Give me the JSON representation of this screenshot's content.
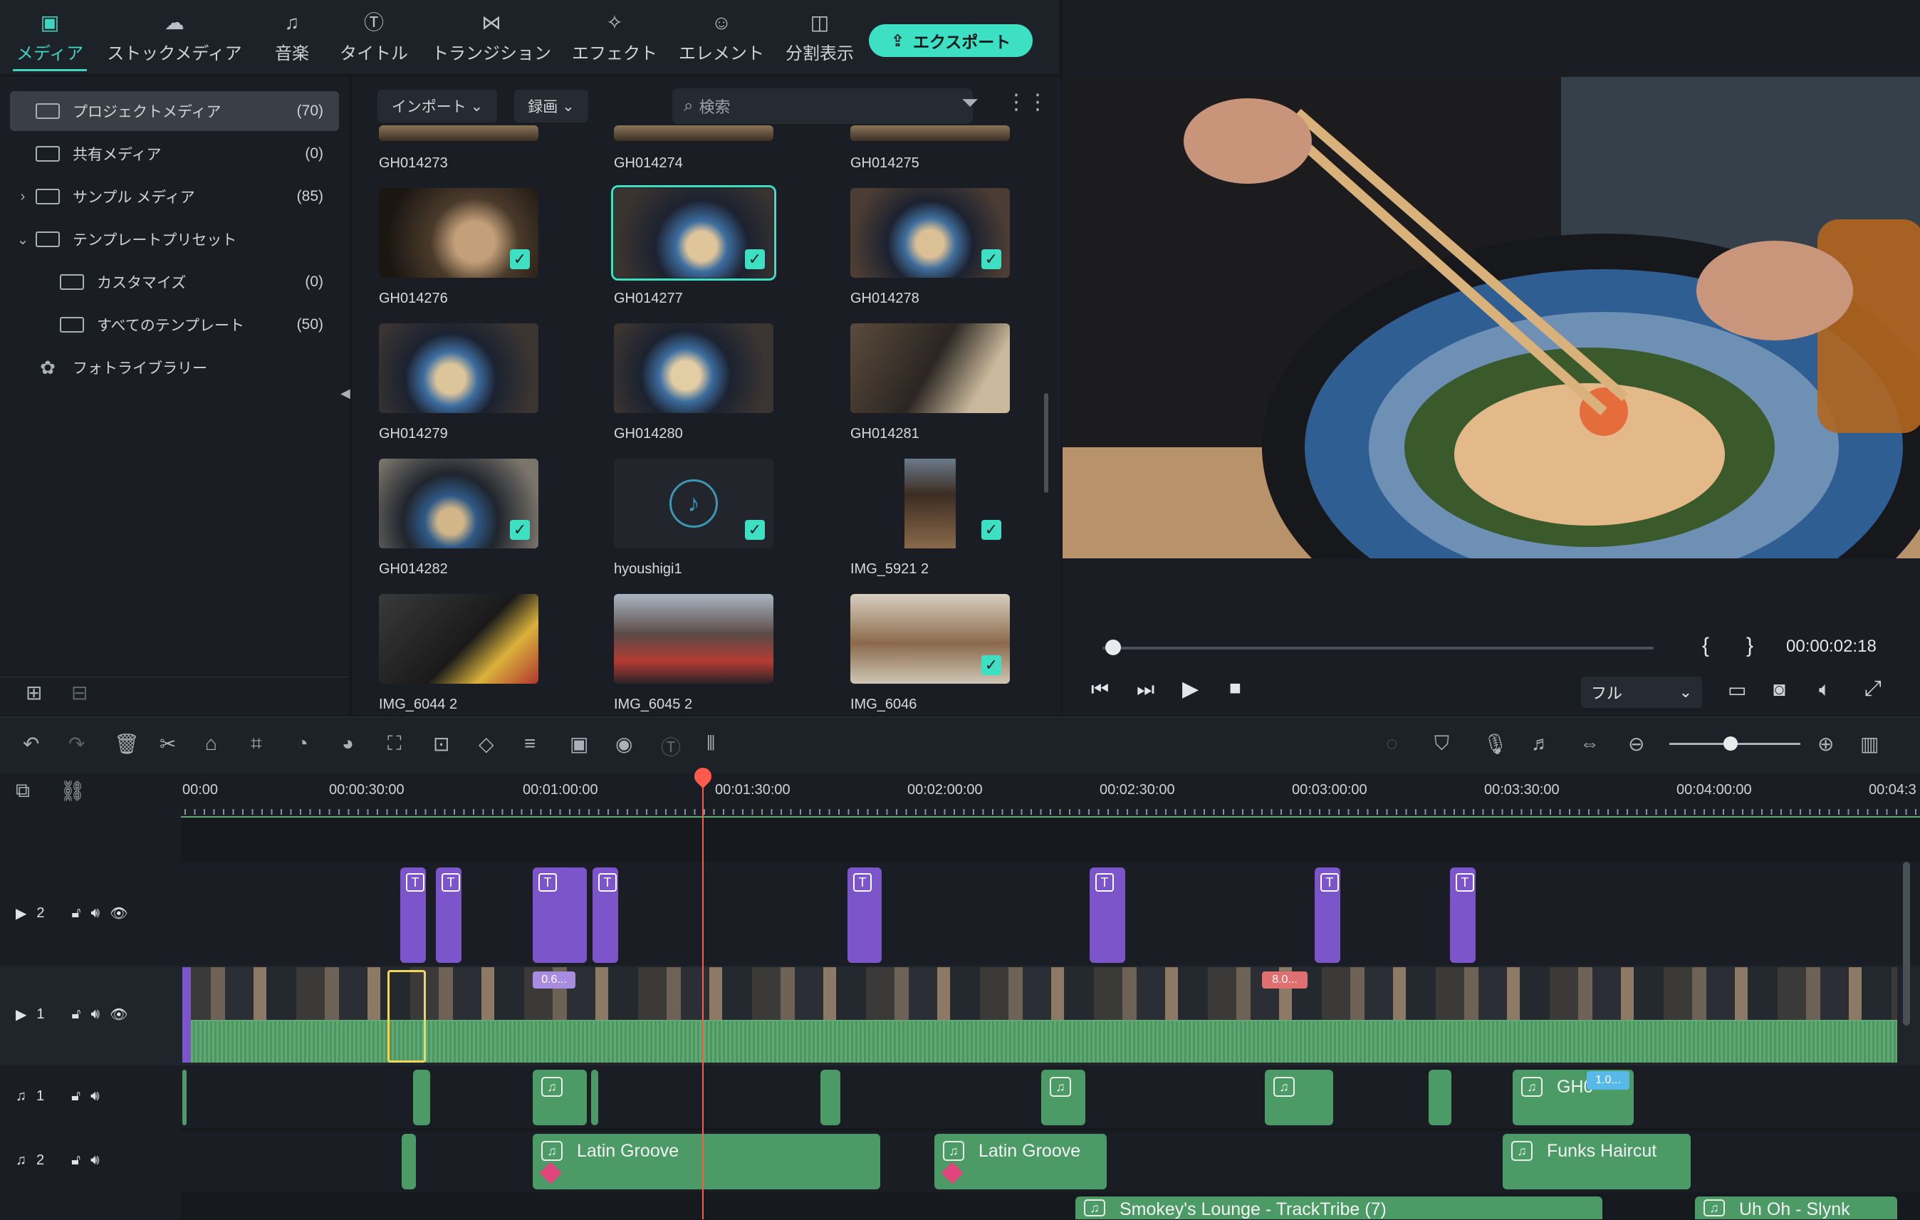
{
  "tabs": [
    {
      "label": "メディア",
      "icon": "media-icon"
    },
    {
      "label": "ストックメディア",
      "icon": "stock-media-icon"
    },
    {
      "label": "音楽",
      "icon": "music-icon"
    },
    {
      "label": "タイトル",
      "icon": "title-icon"
    },
    {
      "label": "トランジション",
      "icon": "transition-icon"
    },
    {
      "label": "エフェクト",
      "icon": "effect-icon"
    },
    {
      "label": "エレメント",
      "icon": "element-icon"
    },
    {
      "label": "分割表示",
      "icon": "split-screen-icon"
    }
  ],
  "export_label": "エクスポート",
  "sidebar": {
    "items": [
      {
        "label": "プロジェクトメディア",
        "count": "(70)"
      },
      {
        "label": "共有メディア",
        "count": "(0)"
      },
      {
        "label": "サンプル メディア",
        "count": "(85)"
      },
      {
        "label": "テンプレートプリセット",
        "count": ""
      },
      {
        "label": "カスタマイズ",
        "count": "(0)"
      },
      {
        "label": "すべてのテンプレート",
        "count": "(50)"
      },
      {
        "label": "フォトライブラリー",
        "count": ""
      }
    ]
  },
  "browser": {
    "import_label": "インポート",
    "record_label": "録画",
    "search_placeholder": "検索",
    "items": [
      {
        "name": "GH014273",
        "checked": false
      },
      {
        "name": "GH014274",
        "checked": false
      },
      {
        "name": "GH014275",
        "checked": false
      },
      {
        "name": "GH014276",
        "checked": true
      },
      {
        "name": "GH014277",
        "checked": true
      },
      {
        "name": "GH014278",
        "checked": true
      },
      {
        "name": "GH014279",
        "checked": false
      },
      {
        "name": "GH014280",
        "checked": false
      },
      {
        "name": "GH014281",
        "checked": false
      },
      {
        "name": "GH014282",
        "checked": true
      },
      {
        "name": "hyoushigi1",
        "checked": true
      },
      {
        "name": "IMG_5921 2",
        "checked": true
      },
      {
        "name": "IMG_6044 2",
        "checked": false
      },
      {
        "name": "IMG_6045 2",
        "checked": false
      },
      {
        "name": "IMG_6046",
        "checked": true
      }
    ]
  },
  "preview": {
    "timecode": "00:00:02:18",
    "quality": "フル",
    "mark_in": "{",
    "mark_out": "}"
  },
  "timeline": {
    "ruler": [
      "00:00",
      "00:00:30:00",
      "00:01:00:00",
      "00:01:30:00",
      "00:02:00:00",
      "00:02:30:00",
      "00:03:00:00",
      "00:03:30:00",
      "00:04:00:00",
      "00:04:3"
    ],
    "tracks": [
      {
        "label": "2",
        "kind": "video"
      },
      {
        "label": "1",
        "kind": "video"
      },
      {
        "label": "1",
        "kind": "audio"
      },
      {
        "label": "2",
        "kind": "audio"
      }
    ],
    "video_markers": [
      "0.6...",
      "8.0...",
      "1.0..."
    ],
    "audio_clips": [
      {
        "name": "Latin Groove"
      },
      {
        "name": "Latin Groove"
      },
      {
        "name": "Funks Haircut"
      },
      {
        "name": "Smokey's Lounge - TrackTribe (7)"
      },
      {
        "name": "Uh Oh - Slynk"
      }
    ],
    "audio1_label": "GH0"
  },
  "colors": {
    "accent": "#3ee0c4",
    "playhead": "#ff5a4a",
    "title_clip": "#7b55c9",
    "audio_clip": "#4c9a66"
  }
}
